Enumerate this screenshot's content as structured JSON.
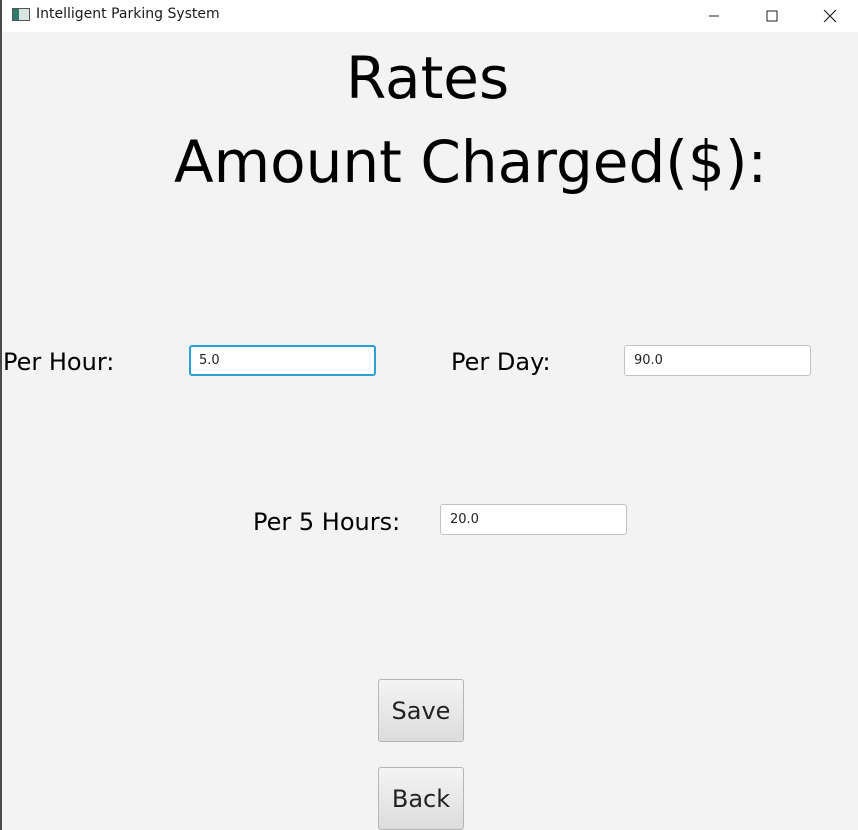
{
  "window": {
    "title": "Intelligent Parking System"
  },
  "page": {
    "title": "Rates",
    "subtitle": "Amount Charged($):"
  },
  "fields": {
    "per_hour": {
      "label": "Per Hour:",
      "value": "5.0"
    },
    "per_day": {
      "label": "Per Day:",
      "value": "90.0"
    },
    "per_5_hours": {
      "label": "Per 5 Hours:",
      "value": "20.0"
    }
  },
  "buttons": {
    "save": "Save",
    "back": "Back"
  },
  "colors": {
    "background": "#f3f3f3",
    "focus_accent": "#2aa1d8"
  }
}
